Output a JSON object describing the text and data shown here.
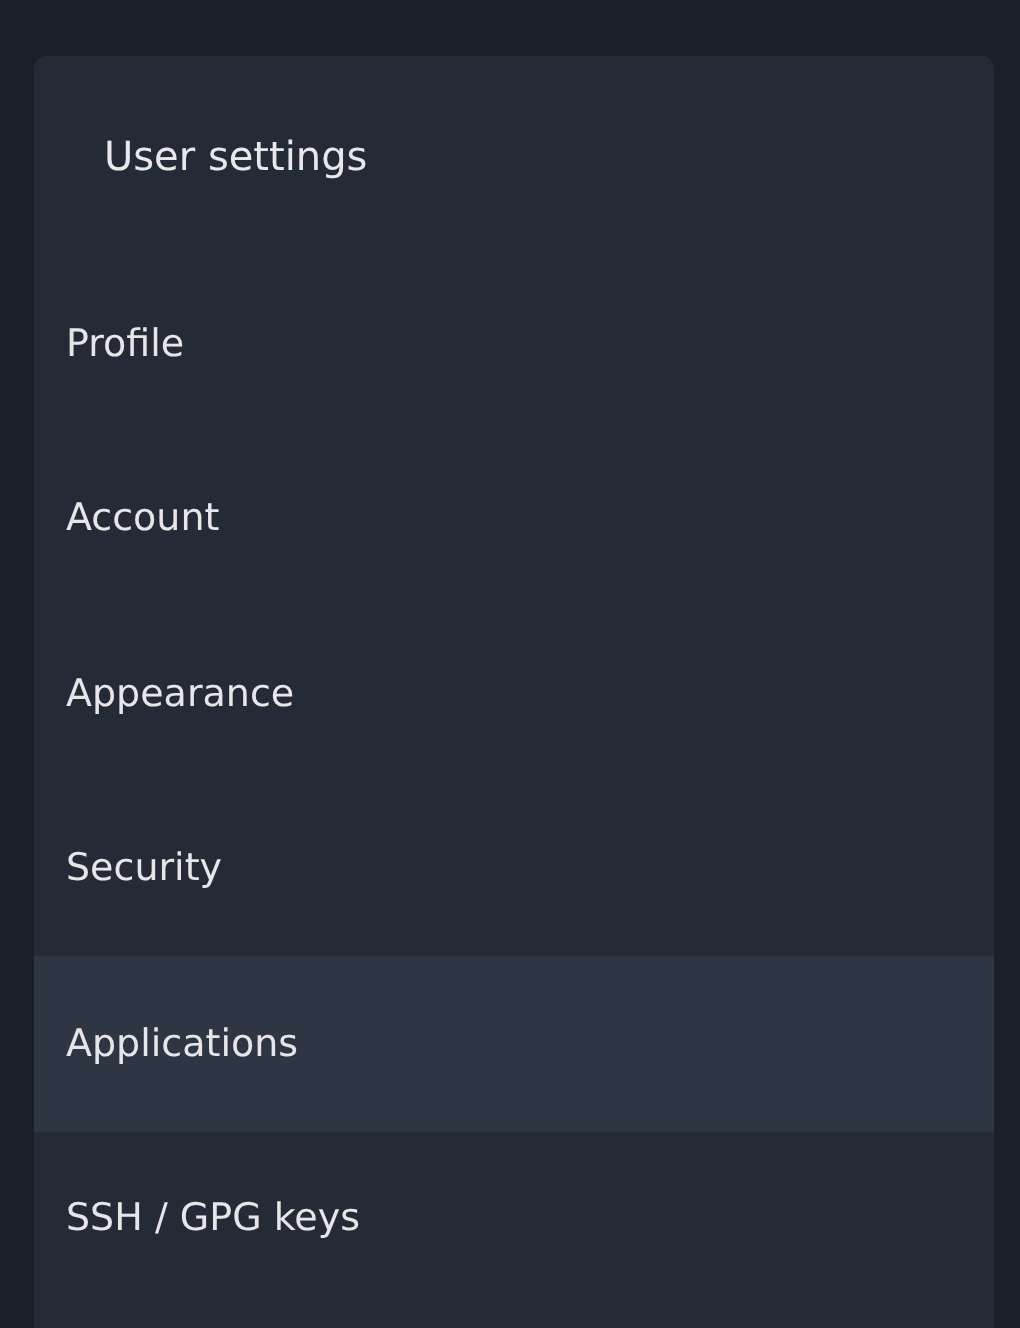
{
  "menu": {
    "title": "User settings",
    "items": [
      {
        "label": "Profile",
        "selected": false
      },
      {
        "label": "Account",
        "selected": false
      },
      {
        "label": "Appearance",
        "selected": false
      },
      {
        "label": "Security",
        "selected": false
      },
      {
        "label": "Applications",
        "selected": true
      },
      {
        "label": "SSH / GPG keys",
        "selected": false
      }
    ]
  }
}
